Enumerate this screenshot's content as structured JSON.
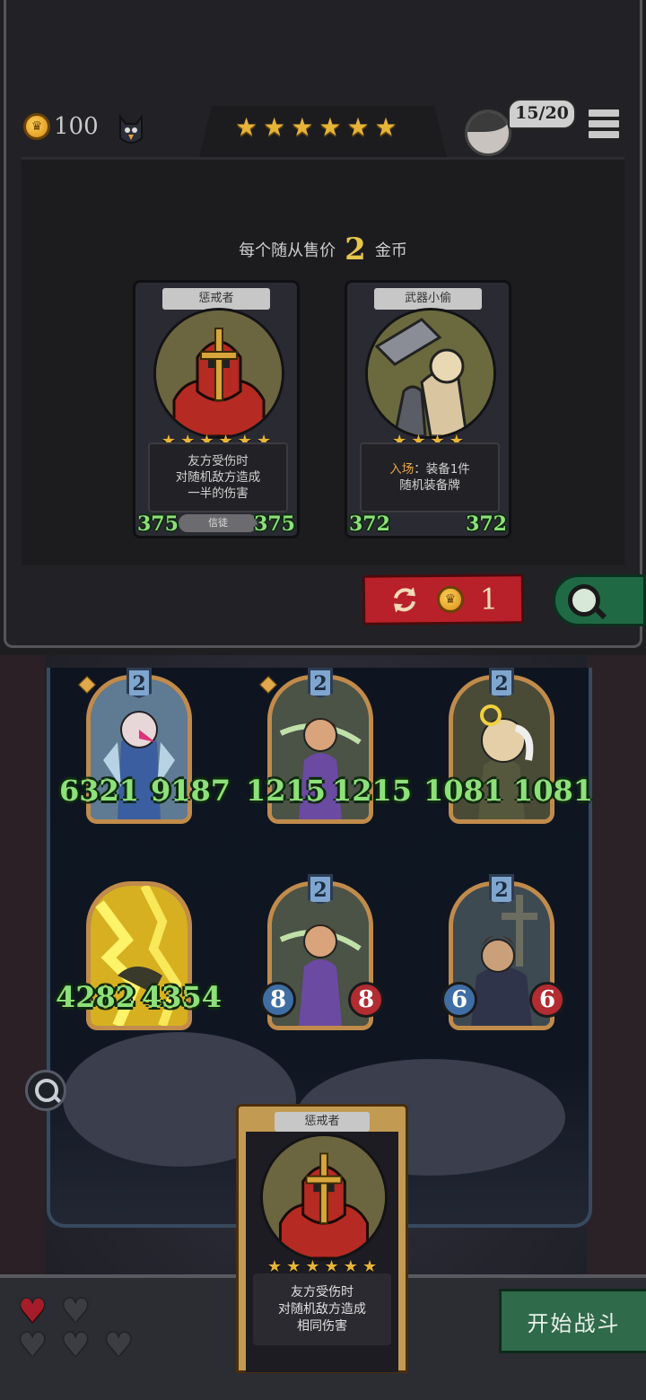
{
  "header": {
    "coins": "100",
    "tier_stars": [
      "★",
      "★",
      "★",
      "★",
      "★",
      "★"
    ],
    "team_count": "15/20"
  },
  "shop": {
    "sell_prefix": "每个随从售价",
    "sell_price": "2",
    "sell_suffix": "金币",
    "cards": [
      {
        "name": "惩戒者",
        "stars": [
          "★",
          "★",
          "★",
          "★",
          "★",
          "★"
        ],
        "desc_lines": [
          "友方受伤时",
          "对随机敌方造成",
          "一半的伤害"
        ],
        "tribe": "信徒",
        "attack": "375",
        "health": "375"
      },
      {
        "name": "武器小偷",
        "stars": [
          "★",
          "★",
          "★",
          "★"
        ],
        "desc_keyword": "入场",
        "desc_lines": [
          "：装备1件",
          "随机装备牌"
        ],
        "attack": "372",
        "health": "372"
      }
    ],
    "refresh_cost": "1"
  },
  "board": {
    "minions": [
      {
        "tier": "2",
        "attack": "6321",
        "health": "9187",
        "style": "green"
      },
      {
        "tier": "2",
        "attack": "1215",
        "health": "1215",
        "style": "green"
      },
      {
        "tier": "2",
        "attack": "1081",
        "health": "1081",
        "style": "green"
      },
      {
        "tier": "",
        "attack": "4282",
        "health": "4354",
        "style": "green"
      },
      {
        "tier": "2",
        "attack": "8",
        "health": "8",
        "style": "orb"
      },
      {
        "tier": "2",
        "attack": "6",
        "health": "6",
        "style": "orb"
      }
    ]
  },
  "hand_card": {
    "name": "惩戒者",
    "stars": [
      "★",
      "★",
      "★",
      "★",
      "★",
      "★"
    ],
    "desc_lines": [
      "友方受伤时",
      "对随机敌方造成",
      "相同伤害"
    ]
  },
  "lives": {
    "remaining": 1,
    "total": 5
  },
  "start_battle_label": "开始战斗",
  "colors": {
    "health_red": "#a51d2a",
    "stat_green": "#8ee07a",
    "refresh_red": "#b8202a",
    "battle_green": "#2f6a4b"
  }
}
